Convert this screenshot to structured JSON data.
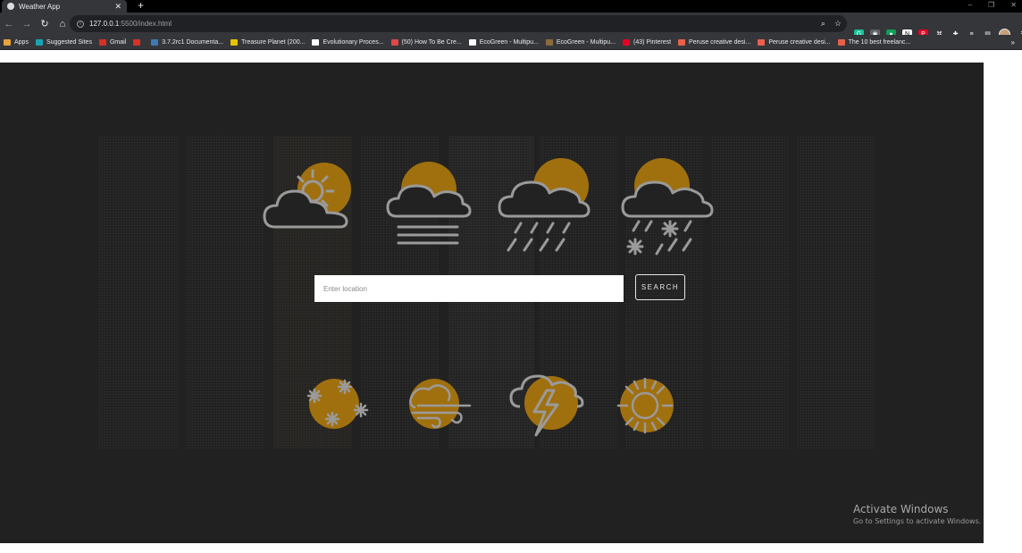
{
  "browser": {
    "tab": {
      "title": "Weather App"
    },
    "new_tab_label": "+",
    "window_controls": [
      "–",
      "❐",
      "✕"
    ],
    "url": {
      "host": "127.0.0.1",
      "rest": ":5500/index.html"
    },
    "bookmarks": [
      {
        "label": "Apps",
        "icon_color": "#e8a33a"
      },
      {
        "label": "Suggested Sites",
        "icon_color": "#1aa3b5"
      },
      {
        "label": "Gmail",
        "icon_color": "#d93025"
      },
      {
        "label": "",
        "icon_color": "#d93025"
      },
      {
        "label": "3.7.2rc1 Documenta...",
        "icon_color": "#3d7ab5"
      },
      {
        "label": "Treasure Planet (200...",
        "icon_color": "#e6c200"
      },
      {
        "label": "Evolutionary Proces...",
        "icon_color": "#ffffff"
      },
      {
        "label": "(50) How To Be Cre...",
        "icon_color": "#e04848"
      },
      {
        "label": "EcoGreen - Multipu...",
        "icon_color": "#ffffff"
      },
      {
        "label": "EcoGreen - Multipu...",
        "icon_color": "#8c6a3e"
      },
      {
        "label": "(43) Pinterest",
        "icon_color": "#e60023"
      },
      {
        "label": "Peruse creative desi...",
        "icon_color": "#e8604c"
      },
      {
        "label": "Peruse creative desi...",
        "icon_color": "#e8604c"
      },
      {
        "label": "The 10 best freelanc...",
        "icon_color": "#e8604c"
      }
    ],
    "bookmarks_more": "»"
  },
  "page": {
    "search": {
      "placeholder": "Enter location",
      "value": "",
      "button_label": "SEARCH"
    },
    "colors": {
      "background": "#212121",
      "sun": "#a0700f",
      "line": "#9a9a9a"
    },
    "weather_icons_top": [
      "partly-cloudy-icon",
      "fog-icon",
      "rain-icon",
      "sleet-icon"
    ],
    "weather_icons_bottom": [
      "snow-icon",
      "wind-icon",
      "thunderstorm-icon",
      "sunny-icon"
    ]
  },
  "watermark": {
    "title": "Activate Windows",
    "subtitle": "Go to Settings to activate Windows."
  }
}
